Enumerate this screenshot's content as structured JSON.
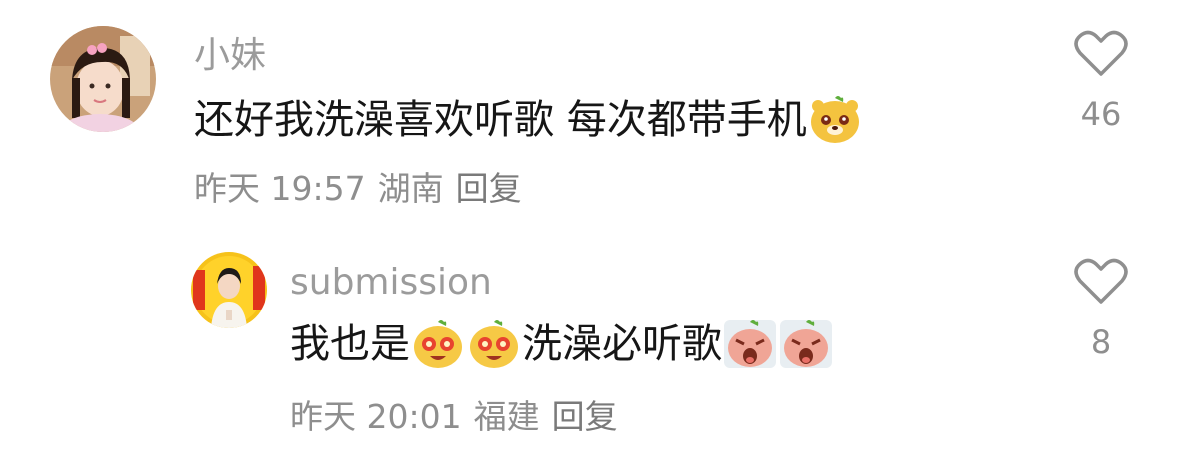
{
  "comments": [
    {
      "username": "小妹",
      "text_parts": [
        "还好我洗澡喜欢听歌 每次都带手机"
      ],
      "trailing_emoji": "bear-emoji",
      "time": "昨天 19:57",
      "location": "湖南",
      "reply_label": "回复",
      "likes": "46"
    },
    {
      "username": "submission",
      "text_before": "我也是",
      "text_middle": "洗澡必听歌",
      "emojis": [
        "star-eyes-emoji",
        "star-eyes-emoji",
        "crying-emoji",
        "crying-emoji"
      ],
      "time": "昨天 20:01",
      "location": "福建",
      "reply_label": "回复",
      "likes": "8"
    }
  ],
  "colors": {
    "username": "#9b9b9b",
    "text": "#161616",
    "meta": "#8e8e8e",
    "emoji_yellow": "#f6c945"
  }
}
